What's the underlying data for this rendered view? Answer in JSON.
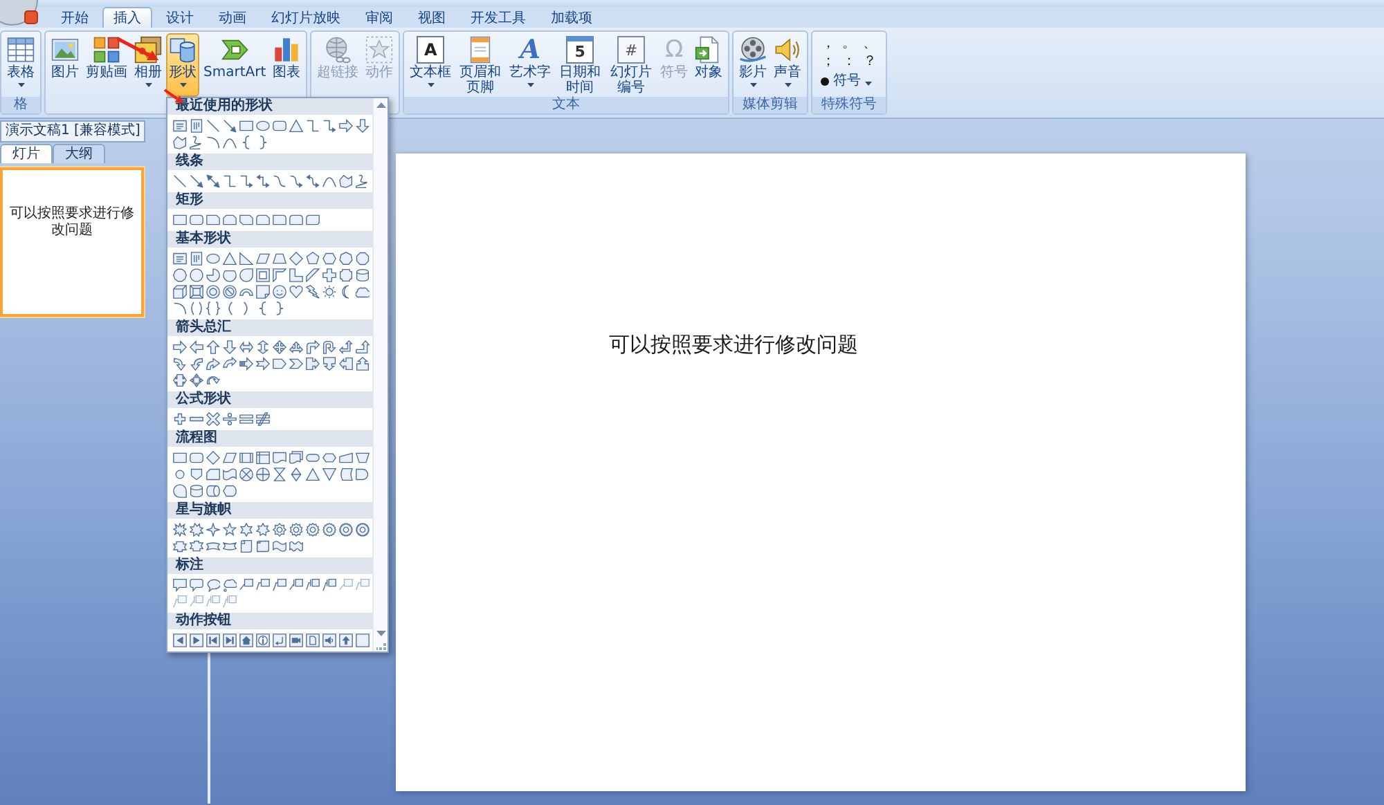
{
  "tabs": [
    {
      "label": "开始",
      "selected": false
    },
    {
      "label": "插入",
      "selected": true
    },
    {
      "label": "设计",
      "selected": false
    },
    {
      "label": "动画",
      "selected": false
    },
    {
      "label": "幻灯片放映",
      "selected": false
    },
    {
      "label": "审阅",
      "selected": false
    },
    {
      "label": "视图",
      "selected": false
    },
    {
      "label": "开发工具",
      "selected": false
    },
    {
      "label": "加载项",
      "selected": false
    }
  ],
  "ribbon": {
    "groups": [
      {
        "kind": "buttons",
        "label": "格",
        "buttons": [
          {
            "label": "表格",
            "kind": "table",
            "dropdown": true,
            "disabled": false,
            "active": false
          }
        ]
      },
      {
        "kind": "buttons",
        "buttons": [
          {
            "label": "图片",
            "kind": "picture",
            "dropdown": false,
            "disabled": false,
            "active": false
          },
          {
            "label": "剪贴画",
            "kind": "clipart",
            "dropdown": false,
            "disabled": false,
            "active": false
          },
          {
            "label": "相册",
            "kind": "album",
            "dropdown": true,
            "disabled": false,
            "active": false
          },
          {
            "label": "形状",
            "kind": "shapes",
            "dropdown": true,
            "disabled": false,
            "active": true
          },
          {
            "label": "SmartArt",
            "kind": "smartart",
            "dropdown": false,
            "disabled": false,
            "active": false
          },
          {
            "label": "图表",
            "kind": "chart",
            "dropdown": false,
            "disabled": false,
            "active": false
          }
        ]
      },
      {
        "kind": "buttons",
        "buttons": [
          {
            "label": "超链接",
            "kind": "hyperlink",
            "dropdown": false,
            "disabled": true,
            "active": false
          },
          {
            "label": "动作",
            "kind": "action",
            "dropdown": false,
            "disabled": true,
            "active": false
          }
        ]
      },
      {
        "kind": "buttons",
        "label": "文本",
        "buttons": [
          {
            "label": "文本框",
            "kind": "textbox",
            "glyph": "A",
            "dropdown": true,
            "disabled": false,
            "active": false
          },
          {
            "label": "页眉和页脚",
            "kind": "header",
            "dropdown": false,
            "disabled": false,
            "active": false
          },
          {
            "label": "艺术字",
            "kind": "wordart",
            "glyph": "A",
            "dropdown": true,
            "disabled": false,
            "active": false
          },
          {
            "label": "日期和时间",
            "kind": "datetime",
            "glyph": "5",
            "dropdown": false,
            "disabled": false,
            "active": false
          },
          {
            "label": "幻灯片编号",
            "kind": "slidenumber",
            "glyph": "#",
            "dropdown": false,
            "disabled": false,
            "active": false
          },
          {
            "label": "符号",
            "kind": "symbol",
            "glyph": "Ω",
            "dropdown": false,
            "disabled": true,
            "active": false
          },
          {
            "label": "对象",
            "kind": "object",
            "dropdown": false,
            "disabled": false,
            "active": false
          }
        ]
      },
      {
        "kind": "buttons",
        "label": "媒体剪辑",
        "buttons": [
          {
            "label": "影片",
            "kind": "movie",
            "dropdown": true,
            "disabled": false,
            "active": false
          },
          {
            "label": "声音",
            "kind": "sound",
            "dropdown": true,
            "disabled": false,
            "active": false
          }
        ]
      },
      {
        "kind": "symbols",
        "label": "特殊符号",
        "symbols": [
          "，",
          "。",
          "、",
          "；",
          "：",
          "？"
        ],
        "menu": {
          "label": "符号",
          "dropdown": true
        }
      }
    ]
  },
  "shapes_gallery": {
    "sections": [
      {
        "title": "最近使用的形状",
        "shapes": [
          {
            "kind": "textbox"
          },
          {
            "kind": "vtextbox"
          },
          {
            "kind": "line"
          },
          {
            "kind": "arrowline"
          },
          {
            "kind": "rect"
          },
          {
            "kind": "oval"
          },
          {
            "kind": "rounded"
          },
          {
            "kind": "triangle"
          },
          {
            "kind": "elbow"
          },
          {
            "kind": "elbowarrow"
          },
          {
            "kind": "rarrow"
          },
          {
            "kind": "darrow"
          },
          {
            "kind": "freeform"
          },
          {
            "kind": "scribble"
          },
          {
            "kind": "arc"
          },
          {
            "kind": "curve"
          },
          {
            "kind": "lbrace"
          },
          {
            "kind": "rbrace"
          }
        ]
      },
      {
        "title": "线条",
        "shapes": [
          {
            "kind": "line"
          },
          {
            "kind": "arrowline"
          },
          {
            "kind": "dblarrow"
          },
          {
            "kind": "elbow"
          },
          {
            "kind": "elbowarrow"
          },
          {
            "kind": "elbowdbl"
          },
          {
            "kind": "scurve"
          },
          {
            "kind": "scurvearrow"
          },
          {
            "kind": "scurvedbl"
          },
          {
            "kind": "curve"
          },
          {
            "kind": "freeform"
          },
          {
            "kind": "scribble"
          }
        ]
      },
      {
        "title": "矩形",
        "shapes": [
          {
            "kind": "rect"
          },
          {
            "kind": "rounded"
          },
          {
            "kind": "snip"
          },
          {
            "kind": "snip2"
          },
          {
            "kind": "snipdiag"
          },
          {
            "kind": "snipround"
          },
          {
            "kind": "round1"
          },
          {
            "kind": "roundtop"
          },
          {
            "kind": "rounddiag"
          }
        ]
      },
      {
        "title": "基本形状",
        "shapes": [
          {
            "kind": "textbox"
          },
          {
            "kind": "vtextbox"
          },
          {
            "kind": "oval"
          },
          {
            "kind": "triangle"
          },
          {
            "kind": "rtriangle"
          },
          {
            "kind": "parallelogram"
          },
          {
            "kind": "trapezoid"
          },
          {
            "kind": "diamond"
          },
          {
            "kind": "pentagon"
          },
          {
            "kind": "hexagon"
          },
          {
            "kind": "heptagon"
          },
          {
            "kind": "octagon"
          },
          {
            "kind": "decagon"
          },
          {
            "kind": "dodecagon"
          },
          {
            "kind": "pie"
          },
          {
            "kind": "chord"
          },
          {
            "kind": "teardrop"
          },
          {
            "kind": "frame"
          },
          {
            "kind": "halfframe"
          },
          {
            "kind": "lshape"
          },
          {
            "kind": "diagstripe"
          },
          {
            "kind": "plus"
          },
          {
            "kind": "plaque"
          },
          {
            "kind": "can"
          },
          {
            "kind": "cube"
          },
          {
            "kind": "bevel"
          },
          {
            "kind": "donut"
          },
          {
            "kind": "nosymbol"
          },
          {
            "kind": "blockarc"
          },
          {
            "kind": "folded"
          },
          {
            "kind": "smiley"
          },
          {
            "kind": "heart"
          },
          {
            "kind": "lightning"
          },
          {
            "kind": "sun"
          },
          {
            "kind": "moon"
          },
          {
            "kind": "cloud"
          },
          {
            "kind": "arc"
          },
          {
            "kind": "dblbracket"
          },
          {
            "kind": "dblbrace"
          },
          {
            "kind": "lbracket"
          },
          {
            "kind": "rbracket"
          },
          {
            "kind": "lbrace"
          },
          {
            "kind": "rbrace"
          }
        ]
      },
      {
        "title": "箭头总汇",
        "shapes": [
          {
            "kind": "rarrow"
          },
          {
            "kind": "larrow"
          },
          {
            "kind": "uarrow"
          },
          {
            "kind": "darrow"
          },
          {
            "kind": "lrarrow"
          },
          {
            "kind": "udarrow"
          },
          {
            "kind": "quadarrow"
          },
          {
            "kind": "triarrow"
          },
          {
            "kind": "bentarrow"
          },
          {
            "kind": "uturn"
          },
          {
            "kind": "leftup"
          },
          {
            "kind": "bentup"
          },
          {
            "kind": "curvedr"
          },
          {
            "kind": "curvedl"
          },
          {
            "kind": "curvedu"
          },
          {
            "kind": "curvedd"
          },
          {
            "kind": "stripedr"
          },
          {
            "kind": "notchedr"
          },
          {
            "kind": "homeplate"
          },
          {
            "kind": "chevron"
          },
          {
            "kind": "calloutr"
          },
          {
            "kind": "calloutd"
          },
          {
            "kind": "calloutl"
          },
          {
            "kind": "calloutu"
          },
          {
            "kind": "calloutlr"
          },
          {
            "kind": "calloutquad"
          },
          {
            "kind": "circular"
          }
        ]
      },
      {
        "title": "公式形状",
        "shapes": [
          {
            "kind": "mplus"
          },
          {
            "kind": "minus"
          },
          {
            "kind": "multiply"
          },
          {
            "kind": "divide"
          },
          {
            "kind": "equal"
          },
          {
            "kind": "notequal"
          }
        ]
      },
      {
        "title": "流程图",
        "shapes": [
          {
            "kind": "rect"
          },
          {
            "kind": "rounded"
          },
          {
            "kind": "diamond"
          },
          {
            "kind": "parallelogram"
          },
          {
            "kind": "predefined"
          },
          {
            "kind": "internal"
          },
          {
            "kind": "document"
          },
          {
            "kind": "multidoc"
          },
          {
            "kind": "terminator"
          },
          {
            "kind": "preparation"
          },
          {
            "kind": "manualinput"
          },
          {
            "kind": "manualop"
          },
          {
            "kind": "connector"
          },
          {
            "kind": "offpage"
          },
          {
            "kind": "card"
          },
          {
            "kind": "punched"
          },
          {
            "kind": "summing"
          },
          {
            "kind": "orgate"
          },
          {
            "kind": "collate"
          },
          {
            "kind": "sort"
          },
          {
            "kind": "triangle"
          },
          {
            "kind": "merge"
          },
          {
            "kind": "stored"
          },
          {
            "kind": "delay"
          },
          {
            "kind": "sequential"
          },
          {
            "kind": "can"
          },
          {
            "kind": "direct"
          },
          {
            "kind": "display"
          }
        ]
      },
      {
        "title": "星与旗帜",
        "shapes": [
          {
            "kind": "burst"
          },
          {
            "kind": "burst2"
          },
          {
            "kind": "star4"
          },
          {
            "kind": "star5"
          },
          {
            "kind": "star6"
          },
          {
            "kind": "star7"
          },
          {
            "kind": "star8"
          },
          {
            "kind": "star10"
          },
          {
            "kind": "star12"
          },
          {
            "kind": "star16"
          },
          {
            "kind": "star24"
          },
          {
            "kind": "star32"
          },
          {
            "kind": "ribbonup"
          },
          {
            "kind": "ribbondown"
          },
          {
            "kind": "curvedup"
          },
          {
            "kind": "curveddown"
          },
          {
            "kind": "vscroll"
          },
          {
            "kind": "hscroll"
          },
          {
            "kind": "wave"
          },
          {
            "kind": "dwave"
          }
        ]
      },
      {
        "title": "标注",
        "shapes": [
          {
            "kind": "rectcallout"
          },
          {
            "kind": "roundcallout"
          },
          {
            "kind": "ovalcallout"
          },
          {
            "kind": "cloudcallout"
          },
          {
            "kind": "linecallout"
          },
          {
            "kind": "bentcallout"
          },
          {
            "kind": "dblcallout"
          },
          {
            "kind": "accentcallout"
          },
          {
            "kind": "accentbent"
          },
          {
            "kind": "accentdbl"
          },
          {
            "kind": "plainline"
          },
          {
            "kind": "plainbent"
          },
          {
            "kind": "plaindbl"
          },
          {
            "kind": "plainaccent"
          },
          {
            "kind": "plainaccentbent"
          },
          {
            "kind": "plainaccentdbl"
          }
        ]
      },
      {
        "title": "动作按钮",
        "shapes": [
          {
            "kind": "back"
          },
          {
            "kind": "forward"
          },
          {
            "kind": "begin"
          },
          {
            "kind": "end"
          },
          {
            "kind": "home"
          },
          {
            "kind": "info"
          },
          {
            "kind": "return"
          },
          {
            "kind": "movie"
          },
          {
            "kind": "docbutton"
          },
          {
            "kind": "soundbutton"
          },
          {
            "kind": "upbutton"
          },
          {
            "kind": "blank"
          }
        ]
      }
    ]
  },
  "document_title": "演示文稿1 [兼容模式]",
  "panel_tabs": [
    {
      "label": "灯片",
      "selected": true
    },
    {
      "label": "大纲",
      "selected": false
    }
  ],
  "slides": [
    {
      "text": "可以按照要求进行修改问题",
      "selected": true
    }
  ],
  "slide": {
    "text": "可以按照要求进行修改问题"
  }
}
